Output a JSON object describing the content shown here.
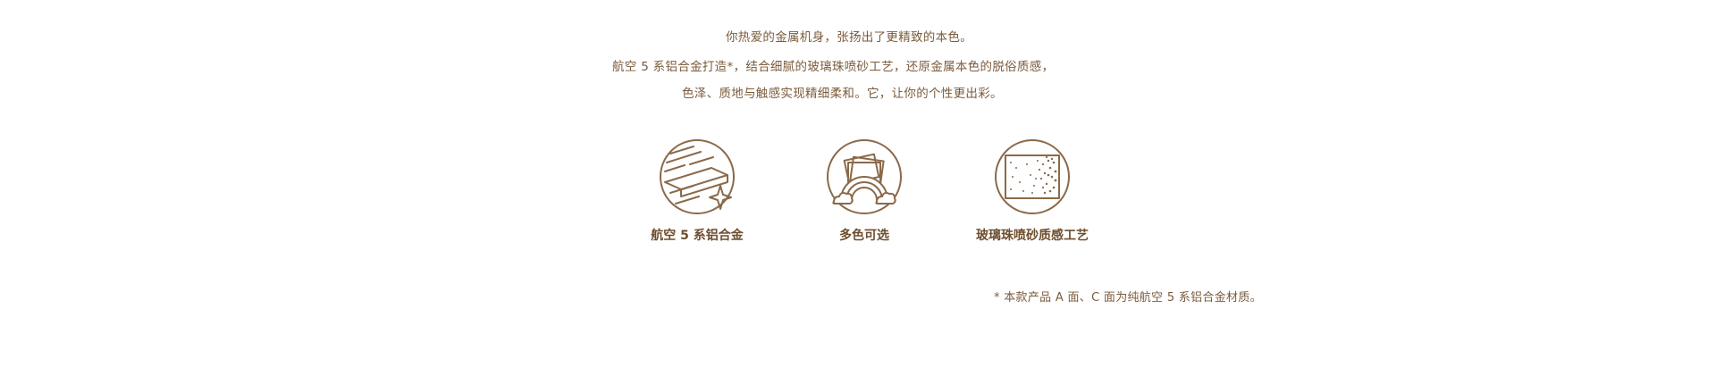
{
  "intro": {
    "line1": "你热爱的金属机身，张扬出了更精致的本色。",
    "line2": "航空 5 系铝合金打造*，结合细腻的玻璃珠喷砂工艺，还原金属本色的脱俗质感，",
    "line3": "色泽、质地与触感实现精细柔和。它，让你的个性更出彩。"
  },
  "features": [
    {
      "icon": "aluminum-alloy-icon",
      "label": "航空 5 系铝合金"
    },
    {
      "icon": "multi-color-icon",
      "label": "多色可选"
    },
    {
      "icon": "sandblast-icon",
      "label": "玻璃珠喷砂质感工艺"
    }
  ],
  "footnote": "* 本款产品 A 面、C 面为纯航空 5 系铝合金材质。",
  "colors": {
    "text": "#7b5b3b",
    "icon_stroke": "#8a6a4a"
  }
}
